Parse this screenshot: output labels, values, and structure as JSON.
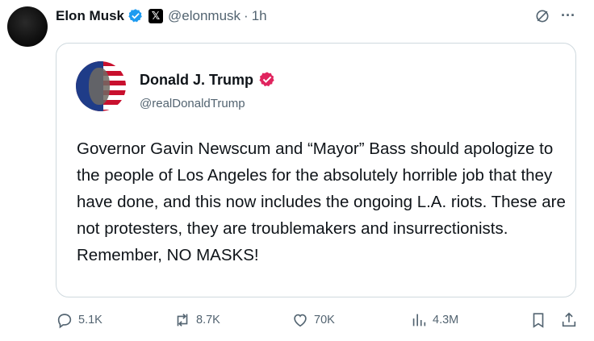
{
  "post": {
    "author_name": "Elon Musk",
    "author_handle": "@elonmusk",
    "separator": "·",
    "time": "1h",
    "badge_x": "𝕏"
  },
  "quote": {
    "author_name": "Donald J. Trump",
    "author_handle": "@realDonaldTrump",
    "text": "Governor Gavin Newscum and “Mayor” Bass should apologize to the people of Los Angeles for the absolutely horrible job that they have done, and this now includes the ongoing L.A. riots. These are not protesters, they are troublemakers and insurrectionists. Remember, NO MASKS!"
  },
  "actions": {
    "replies": "5.1K",
    "reposts": "8.7K",
    "likes": "70K",
    "views": "4.3M"
  },
  "colors": {
    "verified_blue": "#1d9bf0",
    "verified_pink": "#e0245e",
    "muted": "#536471",
    "border": "#cfd9de"
  },
  "icons": {
    "verified": "verified-badge-icon",
    "x_affiliate": "x-logo-icon",
    "grok": "grok-icon",
    "more": "more-icon",
    "reply": "reply-icon",
    "repost": "repost-icon",
    "like": "like-icon",
    "views": "views-icon",
    "bookmark": "bookmark-icon",
    "share": "share-icon"
  }
}
